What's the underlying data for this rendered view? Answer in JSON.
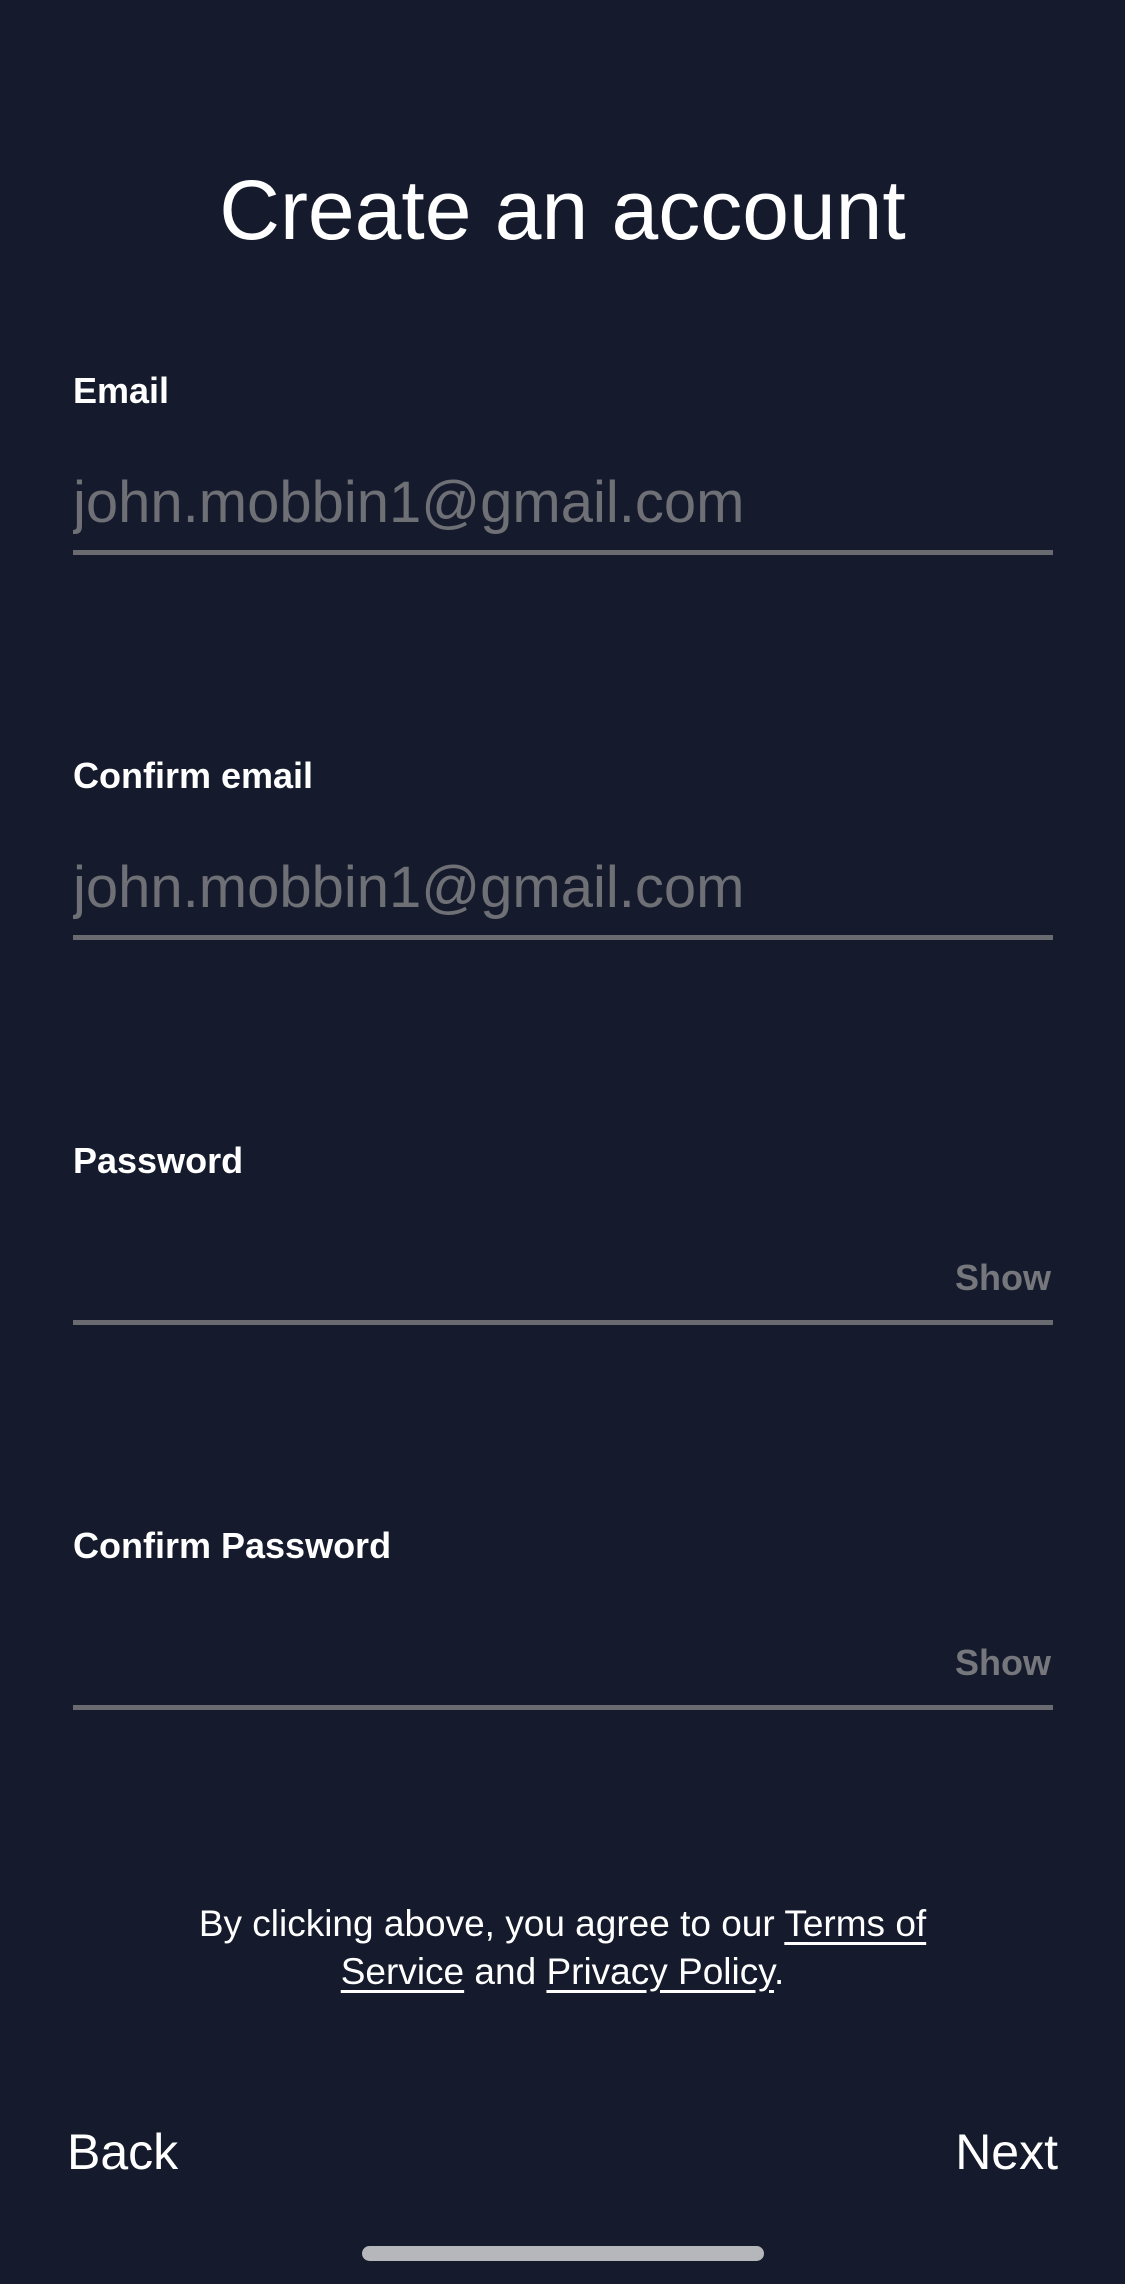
{
  "header": {
    "title": "Create an account"
  },
  "form": {
    "email": {
      "label": "Email",
      "value": "",
      "placeholder": "john.mobbin1@gmail.com"
    },
    "confirm_email": {
      "label": "Confirm email",
      "value": "",
      "placeholder": "john.mobbin1@gmail.com"
    },
    "password": {
      "label": "Password",
      "value": "",
      "placeholder": "",
      "toggle_label": "Show"
    },
    "confirm_password": {
      "label": "Confirm Password",
      "value": "",
      "placeholder": "",
      "toggle_label": "Show"
    }
  },
  "legal": {
    "prefix": "By clicking above, you agree to our ",
    "terms_link": "Terms of Service",
    "middle": " and ",
    "privacy_link": "Privacy Policy",
    "suffix": "."
  },
  "footer": {
    "back_label": "Back",
    "next_label": "Next"
  },
  "colors": {
    "background": "#151b2c",
    "text": "#ffffff",
    "placeholder": "#6e7076",
    "underline": "#6a6b70",
    "toggle": "#76777c",
    "home_indicator": "#b6b7ba"
  }
}
